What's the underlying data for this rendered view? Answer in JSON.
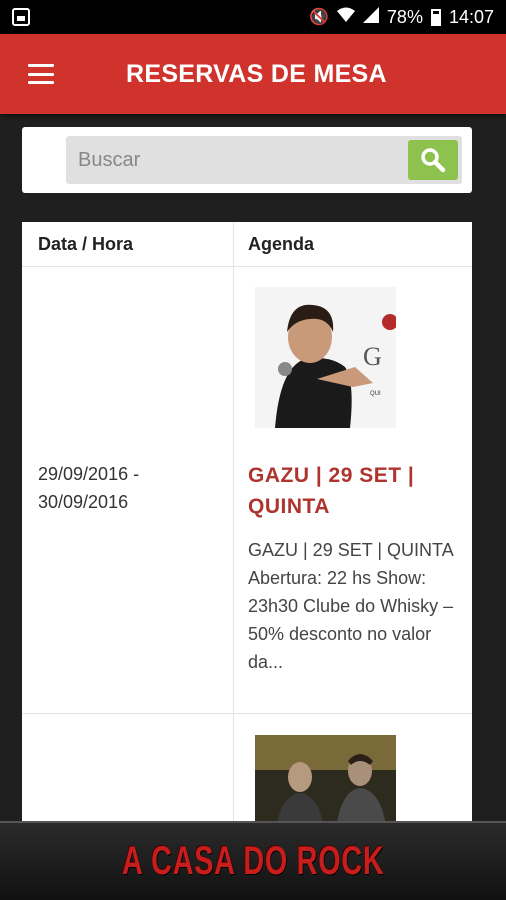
{
  "status_bar": {
    "battery": "78%",
    "time": "14:07"
  },
  "app_bar": {
    "title": "RESERVAS DE MESA"
  },
  "search": {
    "placeholder": "Buscar"
  },
  "table": {
    "headers": [
      "Data / Hora",
      "Agenda"
    ],
    "rows": [
      {
        "date": "29/09/2016 - 30/09/2016",
        "title": "GAZU | 29 SET | QUINTA",
        "description": "GAZU | 29 SET | QUINTA Abertura: 22 hs Show: 23h30 Clube do Whisky – 50% desconto no valor da..."
      }
    ]
  },
  "footer": {
    "banner": "A CASA DO ROCK"
  },
  "colors": {
    "app_bar": "#d0322c",
    "event_title": "#b0342e",
    "search_button": "#8dc24f"
  }
}
